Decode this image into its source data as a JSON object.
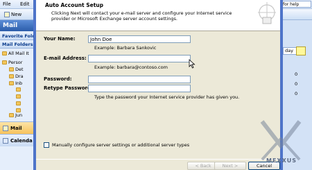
{
  "menubar": {
    "items": [
      "File",
      "Edit"
    ],
    "help_placeholder": "for help"
  },
  "toolbar": {
    "new_label": "New"
  },
  "nav": {
    "title": "Mail",
    "favorite_folders": "Favorite Fold",
    "mail_folders": "Mail Folders",
    "all_mail": "All Mail It",
    "tree": [
      "Persor",
      "Det",
      "Dra",
      "Inb",
      "Jun"
    ],
    "buttons": {
      "mail": "Mail",
      "calendar": "Calenda"
    }
  },
  "right_pane": {
    "field_text": "day",
    "counts": [
      "0",
      "0",
      "0"
    ]
  },
  "dialog": {
    "title": "Auto Account Setup",
    "description": "Clicking Next will contact your e-mail server and configure your Internet service provider or Microsoft Exchange server account settings.",
    "fields": {
      "name": {
        "label": "Your Name:",
        "value": "John Doe",
        "example": "Example: Barbara Sankovic"
      },
      "email": {
        "label": "E-mail Address:",
        "value": "",
        "example": "Example: barbara@contoso.com"
      },
      "password": {
        "label": "Password:",
        "value": ""
      },
      "retype": {
        "label": "Retype Password:",
        "value": ""
      },
      "password_hint": "Type the password your Internet service provider has given you."
    },
    "manual_checkbox": {
      "label": "Manually configure server settings or additional server types",
      "checked": false
    },
    "buttons": {
      "back": "< Back",
      "next": "Next >",
      "cancel": "Cancel"
    }
  },
  "watermark": {
    "text": "MEXXUS"
  },
  "colors": {
    "dialog_border": "#4e74c9",
    "dialog_bg": "#ece9d8",
    "nav_header": "#2a5caa"
  }
}
